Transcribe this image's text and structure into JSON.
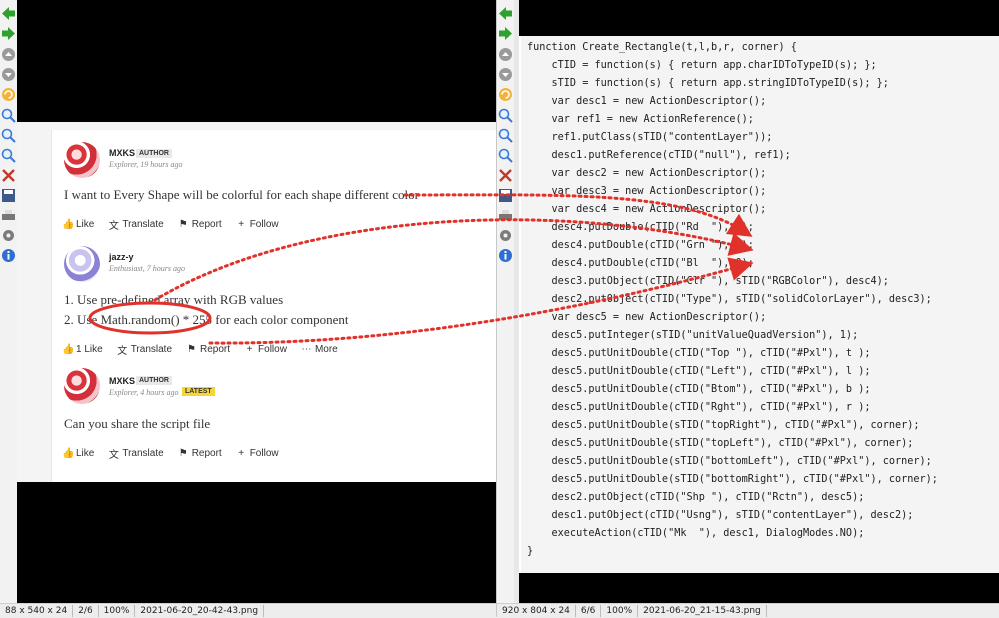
{
  "left_viewer": {
    "toolbar_icons": [
      "back-arrow-icon",
      "forward-arrow-icon",
      "scroll-up-icon",
      "scroll-down-icon",
      "refresh-icon",
      "zoom-in-icon",
      "zoom-fit-icon",
      "zoom-out-icon",
      "delete-icon",
      "save-icon",
      "print-icon",
      "settings-icon",
      "info-icon"
    ],
    "status": {
      "dims": "88 x 540 x 24",
      "index": "2/6",
      "zoom": "100%",
      "filename": "2021-06-20_20-42-43.png"
    }
  },
  "right_viewer": {
    "toolbar_icons": [
      "back-arrow-icon",
      "forward-arrow-icon",
      "scroll-up-icon",
      "scroll-down-icon",
      "refresh-icon",
      "zoom-in-icon",
      "zoom-fit-icon",
      "zoom-out-icon",
      "delete-icon",
      "save-icon",
      "print-icon",
      "settings-icon",
      "info-icon"
    ],
    "status": {
      "dims": "920 x 804 x 24",
      "index": "6/6",
      "zoom": "100%",
      "filename": "2021-06-20_21-15-43.png"
    }
  },
  "posts": [
    {
      "author": "MXKS",
      "badge": "AUTHOR",
      "meta": "Explorer, 19 hours ago",
      "text": "I want to Every Shape will be colorful for each shape different color",
      "actions": {
        "like": "Like",
        "translate": "Translate",
        "report": "Report",
        "follow": "Follow"
      }
    },
    {
      "author": "jazz-y",
      "meta": "Enthusiast, 7 hours ago",
      "line1": "1. Use pre-defined array with RGB values",
      "line2_prefix": "2. Use ",
      "line2_code": "Math.random() * 255",
      "line2_suffix": " for each color component",
      "actions": {
        "like": "1 Like",
        "translate": "Translate",
        "report": "Report",
        "follow": "Follow",
        "more": "More"
      }
    },
    {
      "author": "MXKS",
      "badge": "AUTHOR",
      "badge2": "LATEST",
      "meta": "Explorer, 4 hours ago",
      "text": "Can you share the script file",
      "actions": {
        "like": "Like",
        "translate": "Translate",
        "report": "Report",
        "follow": "Follow"
      }
    }
  ],
  "code_lines": [
    "function Create_Rectangle(t,l,b,r, corner) {",
    "    cTID = function(s) { return app.charIDToTypeID(s); };",
    "    sTID = function(s) { return app.stringIDToTypeID(s); };",
    "    var desc1 = new ActionDescriptor();",
    "    var ref1 = new ActionReference();",
    "    ref1.putClass(sTID(\"contentLayer\"));",
    "    desc1.putReference(cTID(\"null\"), ref1);",
    "    var desc2 = new ActionDescriptor();",
    "    var desc3 = new ActionDescriptor();",
    "    var desc4 = new ActionDescriptor();",
    "    desc4.putDouble(cTID(\"Rd  \"), 0);",
    "    desc4.putDouble(cTID(\"Grn \"), 0);",
    "    desc4.putDouble(cTID(\"Bl  \"), 0);",
    "    desc3.putObject(cTID(\"Clr \"), sTID(\"RGBColor\"), desc4);",
    "    desc2.putObject(cTID(\"Type\"), sTID(\"solidColorLayer\"), desc3);",
    "    var desc5 = new ActionDescriptor();",
    "    desc5.putInteger(sTID(\"unitValueQuadVersion\"), 1);",
    "    desc5.putUnitDouble(cTID(\"Top \"), cTID(\"#Pxl\"), t );",
    "    desc5.putUnitDouble(cTID(\"Left\"), cTID(\"#Pxl\"), l );",
    "    desc5.putUnitDouble(cTID(\"Btom\"), cTID(\"#Pxl\"), b );",
    "    desc5.putUnitDouble(cTID(\"Rght\"), cTID(\"#Pxl\"), r );",
    "    desc5.putUnitDouble(sTID(\"topRight\"), cTID(\"#Pxl\"), corner);",
    "    desc5.putUnitDouble(sTID(\"topLeft\"), cTID(\"#Pxl\"), corner);",
    "    desc5.putUnitDouble(sTID(\"bottomLeft\"), cTID(\"#Pxl\"), corner);",
    "    desc5.putUnitDouble(sTID(\"bottomRight\"), cTID(\"#Pxl\"), corner);",
    "    desc2.putObject(cTID(\"Shp \"), cTID(\"Rctn\"), desc5);",
    "    desc1.putObject(cTID(\"Usng\"), sTID(\"contentLayer\"), desc2);",
    "    executeAction(cTID(\"Mk  \"), desc1, DialogModes.NO);",
    "}"
  ],
  "colors": {
    "annotation": "#e0322b",
    "arrow_green": "#2fa12f",
    "code_bg": "#f4f4f4"
  }
}
